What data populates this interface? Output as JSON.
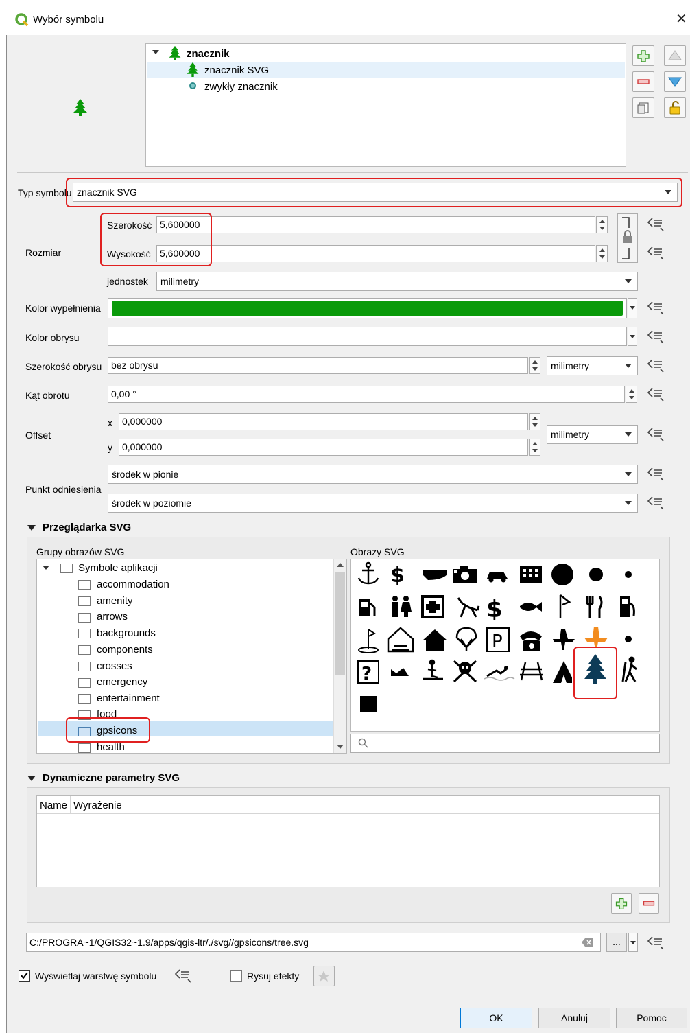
{
  "window": {
    "title": "Wybór symbolu"
  },
  "layers": {
    "root": "znacznik",
    "items": [
      "znacznik SVG",
      "zwykły znacznik"
    ]
  },
  "form": {
    "symbol_type_label": "Typ symbolu",
    "symbol_type_value": "znacznik SVG",
    "size_label": "Rozmiar",
    "width_label": "Szerokość",
    "width_value": "5,600000",
    "height_label": "Wysokość",
    "height_value": "5,600000",
    "unit_label": "jednostek",
    "unit_value": "milimetry",
    "fill_color_label": "Kolor wypełnienia",
    "fill_color": "#0a9a0a",
    "stroke_color_label": "Kolor obrysu",
    "stroke_width_label": "Szerokość obrysu",
    "stroke_width_value": "bez obrysu",
    "stroke_width_unit": "milimetry",
    "rotation_label": "Kąt obrotu",
    "rotation_value": "0,00 °",
    "offset_label": "Offset",
    "offset_x_label": "x",
    "offset_x_value": "0,000000",
    "offset_y_label": "y",
    "offset_y_value": "0,000000",
    "offset_unit": "milimetry",
    "anchor_label": "Punkt odniesienia",
    "anchor_v": "środek w pionie",
    "anchor_h": "środek w poziomie"
  },
  "svg_browser": {
    "title": "Przeglądarka SVG",
    "groups_label": "Grupy obrazów SVG",
    "images_label": "Obrazy SVG",
    "root_group": "Symbole aplikacji",
    "groups": [
      "accommodation",
      "amenity",
      "arrows",
      "backgrounds",
      "components",
      "crosses",
      "emergency",
      "entertainment",
      "food",
      "gpsicons",
      "health"
    ],
    "selected_group": "gpsicons"
  },
  "dynamic_params": {
    "title": "Dynamiczne parametry SVG",
    "col_name": "Name",
    "col_expr": "Wyrażenie"
  },
  "path": {
    "value": "C:/PROGRA~1/QGIS32~1.9/apps/qgis-ltr/./svg//gpsicons/tree.svg",
    "browse": "..."
  },
  "options": {
    "show_layer": "Wyświetlaj warstwę symbolu",
    "draw_effects": "Rysuj efekty"
  },
  "buttons": {
    "ok": "OK",
    "cancel": "Anuluj",
    "help": "Pomoc"
  },
  "colors": {
    "accent_red": "#e02020",
    "tree_dark": "#0d3b57",
    "selected_bg": "#cce4f7"
  }
}
